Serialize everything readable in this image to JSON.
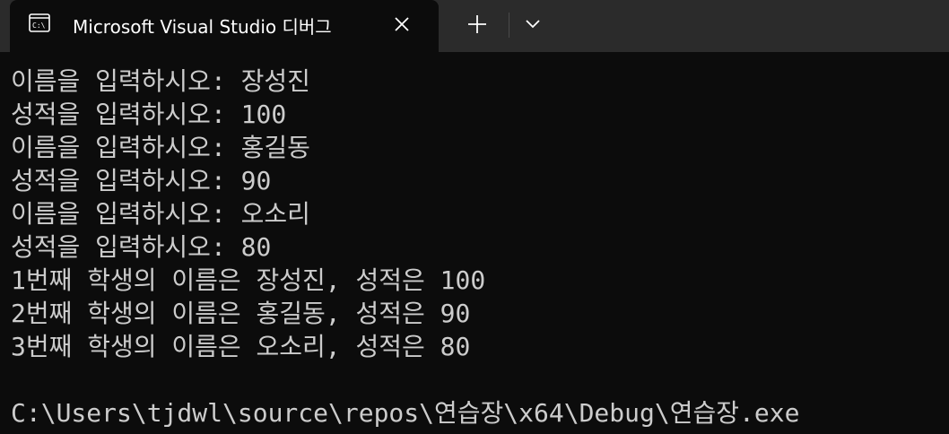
{
  "window": {
    "tab_title": "Microsoft Visual Studio 디버그",
    "icons": {
      "tab": "console-icon",
      "close": "close-icon",
      "new_tab": "plus-icon",
      "dropdown": "chevron-down-icon"
    },
    "colors": {
      "titlebar": "#2b2b2b",
      "console_bg": "#0c0c0c",
      "text": "#cccccc"
    }
  },
  "console": {
    "lines": [
      "이름을 입력하시오: 장성진",
      "성적을 입력하시오: 100",
      "이름을 입력하시오: 홍길동",
      "성적을 입력하시오: 90",
      "이름을 입력하시오: 오소리",
      "성적을 입력하시오: 80",
      "1번째 학생의 이름은 장성진, 성적은 100",
      "2번째 학생의 이름은 홍길동, 성적은 90",
      "3번째 학생의 이름은 오소리, 성적은 80",
      "",
      "C:\\Users\\tjdwl\\source\\repos\\연습장\\x64\\Debug\\연습장.exe"
    ]
  }
}
